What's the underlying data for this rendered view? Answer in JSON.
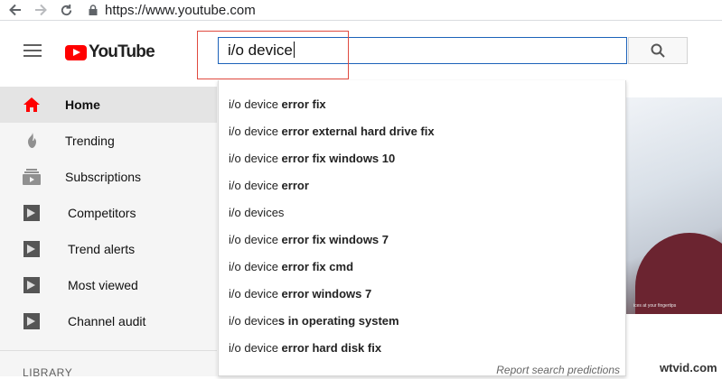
{
  "browser": {
    "url": "https://www.youtube.com"
  },
  "header": {
    "logo_text": "YouTube",
    "search_value": "i/o device",
    "brand_color": "#ff0000",
    "accent_color": "#1c62b9"
  },
  "sidebar": {
    "items": [
      {
        "label": "Home",
        "icon": "home-icon",
        "active": true
      },
      {
        "label": "Trending",
        "icon": "trending-icon"
      },
      {
        "label": "Subscriptions",
        "icon": "subscriptions-icon"
      },
      {
        "label": "Competitors",
        "icon": "channel-icon"
      },
      {
        "label": "Trend alerts",
        "icon": "channel-icon"
      },
      {
        "label": "Most viewed",
        "icon": "channel-icon"
      },
      {
        "label": "Channel audit",
        "icon": "channel-icon"
      }
    ],
    "section_label": "LIBRARY"
  },
  "suggestions": {
    "items": [
      {
        "prefix": "i/o device",
        "suffix": " error fix"
      },
      {
        "prefix": "i/o device",
        "suffix": " error external hard drive fix"
      },
      {
        "prefix": "i/o device",
        "suffix": " error fix windows 10"
      },
      {
        "prefix": "i/o device",
        "suffix": " error"
      },
      {
        "prefix": "i/o device",
        "suffix": "s"
      },
      {
        "prefix": "i/o device",
        "suffix": " error fix windows 7"
      },
      {
        "prefix": "i/o device",
        "suffix": " error fix cmd"
      },
      {
        "prefix": "i/o device",
        "suffix": " error windows 7"
      },
      {
        "prefix": "i/o device",
        "suffix": "s in operating system"
      },
      {
        "prefix": "i/o device",
        "suffix": " error hard disk fix"
      }
    ],
    "report_label": "Report search predictions"
  },
  "video": {
    "caption": "ices at your fingertips"
  },
  "watermark": "wtvid.com"
}
